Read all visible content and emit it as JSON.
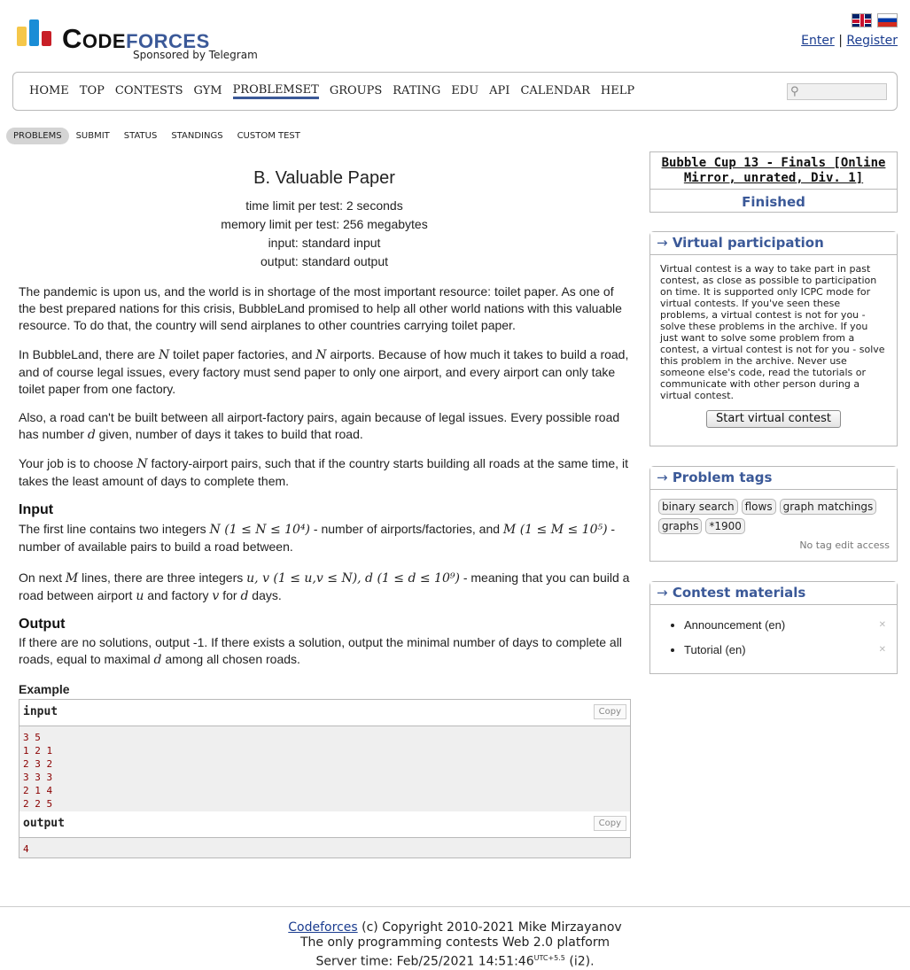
{
  "brand": {
    "name_part1": "Code",
    "name_part2": "forces",
    "sponsor": "Sponsored by Telegram",
    "bar_colors": [
      "#f5c74a",
      "#1a8dd6",
      "#c81f27"
    ]
  },
  "auth": {
    "enter": "Enter",
    "separator": "|",
    "register": "Register"
  },
  "nav": {
    "items": [
      "HOME",
      "TOP",
      "CONTESTS",
      "GYM",
      "PROBLEMSET",
      "GROUPS",
      "RATING",
      "EDU",
      "API",
      "CALENDAR",
      "HELP"
    ],
    "active": "PROBLEMSET",
    "search_placeholder": ""
  },
  "subnav": {
    "items": [
      "PROBLEMS",
      "SUBMIT",
      "STATUS",
      "STANDINGS",
      "CUSTOM TEST"
    ],
    "active": "PROBLEMS"
  },
  "problem": {
    "title": "B. Valuable Paper",
    "time_limit": "time limit per test: 2 seconds",
    "memory_limit": "memory limit per test: 256 megabytes",
    "input": "input: standard input",
    "output": "output: standard output",
    "p1": "The pandemic is upon us, and the world is in shortage of the most important resource: toilet paper. As one of the best prepared nations for this crisis, BubbleLand promised to help all other world nations with this valuable resource. To do that, the country will send airplanes to other countries carrying toilet paper.",
    "p2": {
      "a": "In BubbleLand, there are ",
      "N1": "N",
      "b": " toilet paper factories, and ",
      "N2": "N",
      "c": " airports. Because of how much it takes to build a road, and of course legal issues, every factory must send paper to only one airport, and every airport can only take toilet paper from one factory."
    },
    "p3": {
      "a": "Also, a road can't be built between all airport-factory pairs, again because of legal issues. Every possible road has number ",
      "d": "d",
      "b": " given, number of days it takes to build that road."
    },
    "p4": {
      "a": "Your job is to choose ",
      "N": "N",
      "b": " factory-airport pairs, such that if the country starts building all roads at the same time, it takes the least amount of days to complete them."
    },
    "input_title": "Input",
    "in1": {
      "a": "The first line contains two integers ",
      "m1": "N (1 ≤ N ≤ 10⁴)",
      "b": " - number of airports/factories, and ",
      "m2": "M (1 ≤ M ≤ 10⁵)",
      "c": " - number of available pairs to build a road between."
    },
    "in2": {
      "a": "On next ",
      "M": "M",
      "b": " lines, there are three integers ",
      "m1": "u, v (1 ≤ u,v ≤ N), d (1 ≤ d ≤ 10⁹)",
      "c": " - meaning that you can build a road between airport ",
      "u": "u",
      "d": " and factory ",
      "v": "v",
      "e": " for ",
      "dd": "d",
      "f": " days."
    },
    "output_title": "Output",
    "out1": {
      "a": "If there are no solutions, output -1. If there exists a solution, output the minimal number of days to complete all roads, equal to maximal ",
      "d": "d",
      "b": " among all chosen roads."
    },
    "example_title": "Example",
    "sample_input_label": "input",
    "sample_output_label": "output",
    "copy_label": "Copy",
    "sample_input": "3 5\n1 2 1\n2 3 2\n3 3 3\n2 1 4\n2 2 5",
    "sample_output": "4"
  },
  "sidebar": {
    "contest_name": "Bubble Cup 13 - Finals [Online Mirror, unrated, Div. 1]",
    "contest_phase": "Finished",
    "vp_title": "Virtual participation",
    "vp_text": "Virtual contest is a way to take part in past contest, as close as possible to participation on time. It is supported only ICPC mode for virtual contests. If you've seen these problems, a virtual contest is not for you - solve these problems in the archive. If you just want to solve some problem from a contest, a virtual contest is not for you - solve this problem in the archive. Never use someone else's code, read the tutorials or communicate with other person during a virtual contest.",
    "vp_button": "Start virtual contest",
    "tags_title": "Problem tags",
    "tags": [
      "binary search",
      "flows",
      "graph matchings",
      "graphs",
      "*1900"
    ],
    "tags_note": "No tag edit access",
    "materials_title": "Contest materials",
    "materials": [
      "Announcement (en)",
      "Tutorial (en)"
    ],
    "arrow": "→"
  },
  "footer": {
    "link": "Codeforces",
    "copyright": " (c) Copyright 2010-2021 Mike Mirzayanov",
    "tagline": "The only programming contests Web 2.0 platform",
    "server_time_label": "Server time: Feb/25/2021 14:51:46",
    "tz": "UTC+5.5",
    "server_suffix": " (i2)."
  }
}
